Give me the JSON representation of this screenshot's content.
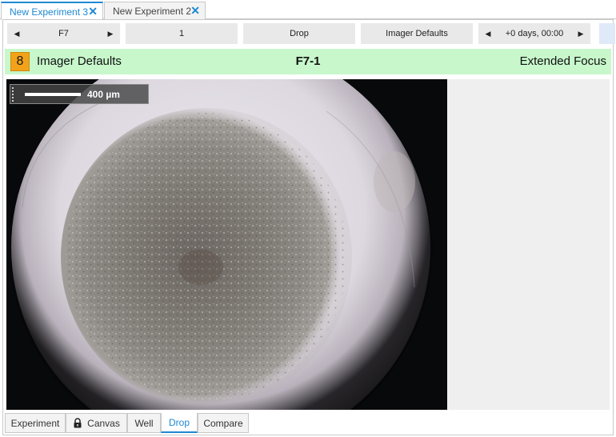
{
  "tabs": [
    {
      "label": "New Experiment 3",
      "active": true,
      "close_icon": "close-icon"
    },
    {
      "label": "New Experiment 2",
      "active": false,
      "close_icon": "close-icon"
    }
  ],
  "close_glyph": "✕",
  "toolbar": {
    "well": {
      "value": "F7",
      "prev_glyph": "◀",
      "next_glyph": "▶"
    },
    "drop": "1",
    "type": "Drop",
    "imager": "Imager Defaults",
    "time": {
      "value": "+0 days, 00:00",
      "prev_glyph": "◀",
      "next_glyph": "▶"
    }
  },
  "header": {
    "badge": "8",
    "left": "Imager Defaults",
    "center": "F7-1",
    "right": "Extended Focus",
    "color": "#c7f7cb",
    "badge_color": "#f2a21a"
  },
  "image": {
    "scale_label": "400 µm"
  },
  "bottom_tabs": [
    {
      "label": "Experiment",
      "active": false
    },
    {
      "label": "Canvas",
      "active": false,
      "icon": "lock-icon"
    },
    {
      "label": "Well",
      "active": false
    },
    {
      "label": "Drop",
      "active": true
    },
    {
      "label": "Compare",
      "active": false
    }
  ],
  "accent": "#1e88d2"
}
